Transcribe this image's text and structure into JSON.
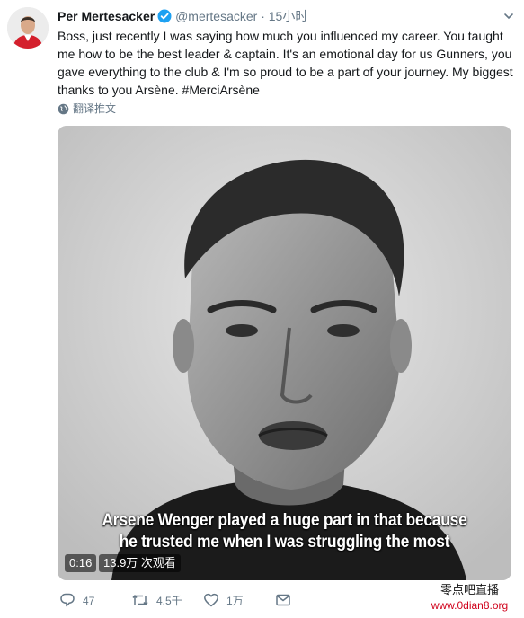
{
  "tweet": {
    "author_name": "Per Mertesacker",
    "handle": "@mertesacker",
    "separator": "·",
    "time": "15小时",
    "text": "Boss, just recently I was saying how much you influenced my career. You taught me how to be the best leader & captain. It's an emotional day for us Gunners, you gave everything to the club & I'm so proud to be a part of your journey. My biggest thanks to you Arsène. #MerciArsène",
    "translate_label": "翻译推文"
  },
  "video": {
    "caption_line1": "Arsene Wenger played a huge part in that because",
    "caption_line2": "he trusted me when I was struggling the most",
    "duration": "0:16",
    "views": "13.9万 次观看"
  },
  "actions": {
    "reply_count": "47",
    "retweet_count": "4.5千",
    "like_count": "1万"
  },
  "watermark": {
    "line1": "零点吧直播",
    "line2": "www.0dian8.org"
  },
  "colors": {
    "verified": "#1da1f2",
    "text": "#14171a",
    "muted": "#657786",
    "watermark_red": "#d0021b"
  },
  "icons": [
    "verified-badge-icon",
    "chevron-down-icon",
    "globe-icon",
    "reply-icon",
    "retweet-icon",
    "like-icon",
    "message-icon"
  ]
}
